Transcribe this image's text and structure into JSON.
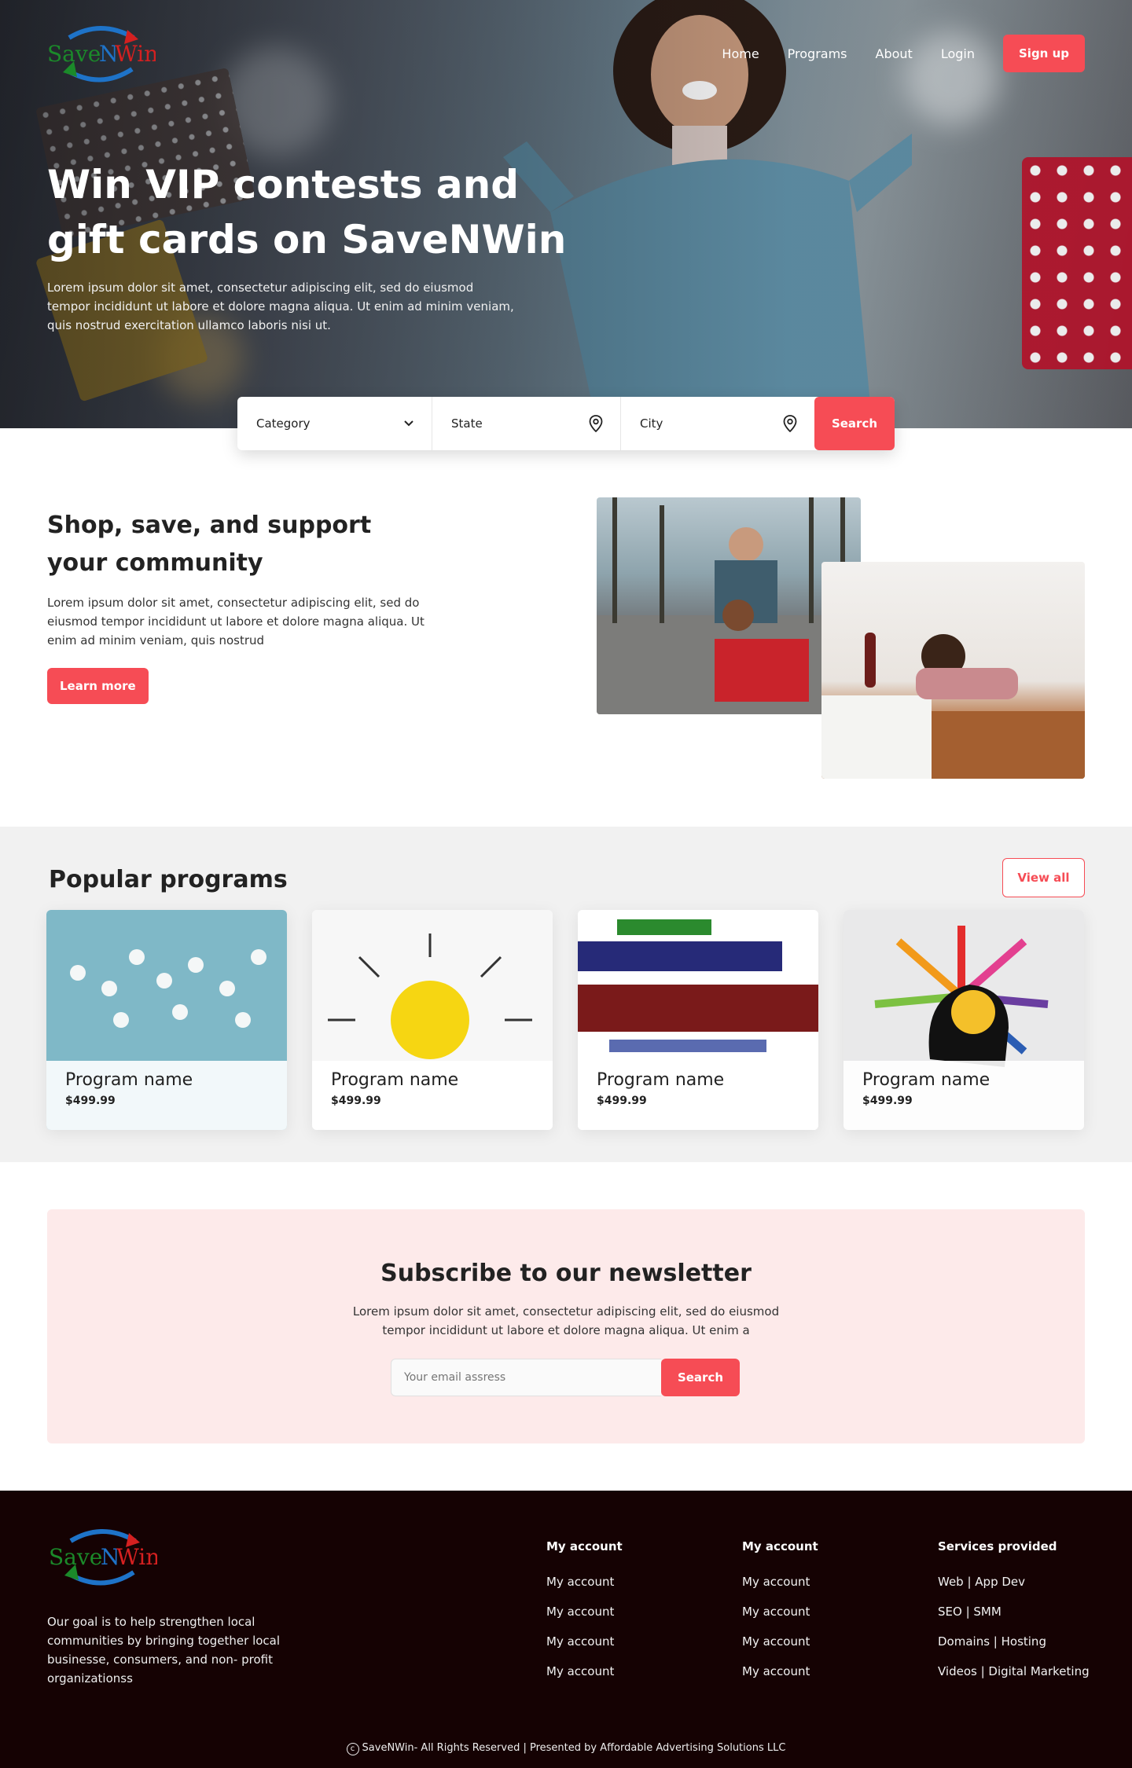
{
  "brand": {
    "name": "SaveNWin",
    "part1": "Save",
    "part2": "N",
    "part3": "Win"
  },
  "nav": {
    "links": [
      "Home",
      "Programs",
      "About",
      "Login"
    ],
    "signup": "Sign up"
  },
  "hero": {
    "title": "Win VIP contests and gift cards on SaveNWin",
    "description": "Lorem ipsum dolor sit amet, consectetur adipiscing elit, sed do eiusmod tempor incididunt ut labore et dolore magna aliqua. Ut enim ad minim veniam, quis nostrud exercitation ullamco laboris nisi ut."
  },
  "search": {
    "category": "Category",
    "state": "State",
    "city": "City",
    "button": "Search"
  },
  "about": {
    "title": "Shop, save, and support your community",
    "description": "Lorem ipsum dolor sit amet, consectetur adipiscing elit, sed do eiusmod tempor incididunt ut labore et dolore magna aliqua. Ut enim ad minim veniam, quis nostrud",
    "button": "Learn more"
  },
  "programs": {
    "title": "Popular programs",
    "view_all": "View all",
    "items": [
      {
        "name": "Program name",
        "price": "$499.99"
      },
      {
        "name": "Program name",
        "price": "$499.99"
      },
      {
        "name": "Program name",
        "price": "$499.99"
      },
      {
        "name": "Program name",
        "price": "$499.99"
      }
    ]
  },
  "newsletter": {
    "title": "Subscribe to our newsletter",
    "description": "Lorem ipsum dolor sit amet, consectetur adipiscing elit, sed do eiusmod tempor incididunt ut labore et dolore magna aliqua. Ut enim a",
    "placeholder": "Your email assress",
    "button": "Search"
  },
  "footer": {
    "about": "Our goal is to help strengthen local communities by bringing together local businesse, consumers, and non- profit organizationss",
    "columns": [
      {
        "title": "My account",
        "links": [
          "My account",
          "My account",
          "My account",
          "My account"
        ]
      },
      {
        "title": "My account",
        "links": [
          "My account",
          "My account",
          "My account",
          "My account"
        ]
      },
      {
        "title": "Services provided",
        "links": [
          "Web | App Dev",
          "SEO | SMM",
          "Domains | Hosting",
          "Videos | Digital Marketing"
        ]
      }
    ],
    "copyright": "SaveNWin- All Rights Reserved | Presented by Affordable Advertising Solutions LLC",
    "copyright_symbol": "c"
  },
  "colors": {
    "accent": "#f64c55",
    "footer_bg": "#150203",
    "newsletter_bg": "#fdeaea",
    "section_bg": "#f1f1f1"
  },
  "icons": {
    "dropdown": "chevron-down-icon",
    "location": "map-pin-icon"
  }
}
